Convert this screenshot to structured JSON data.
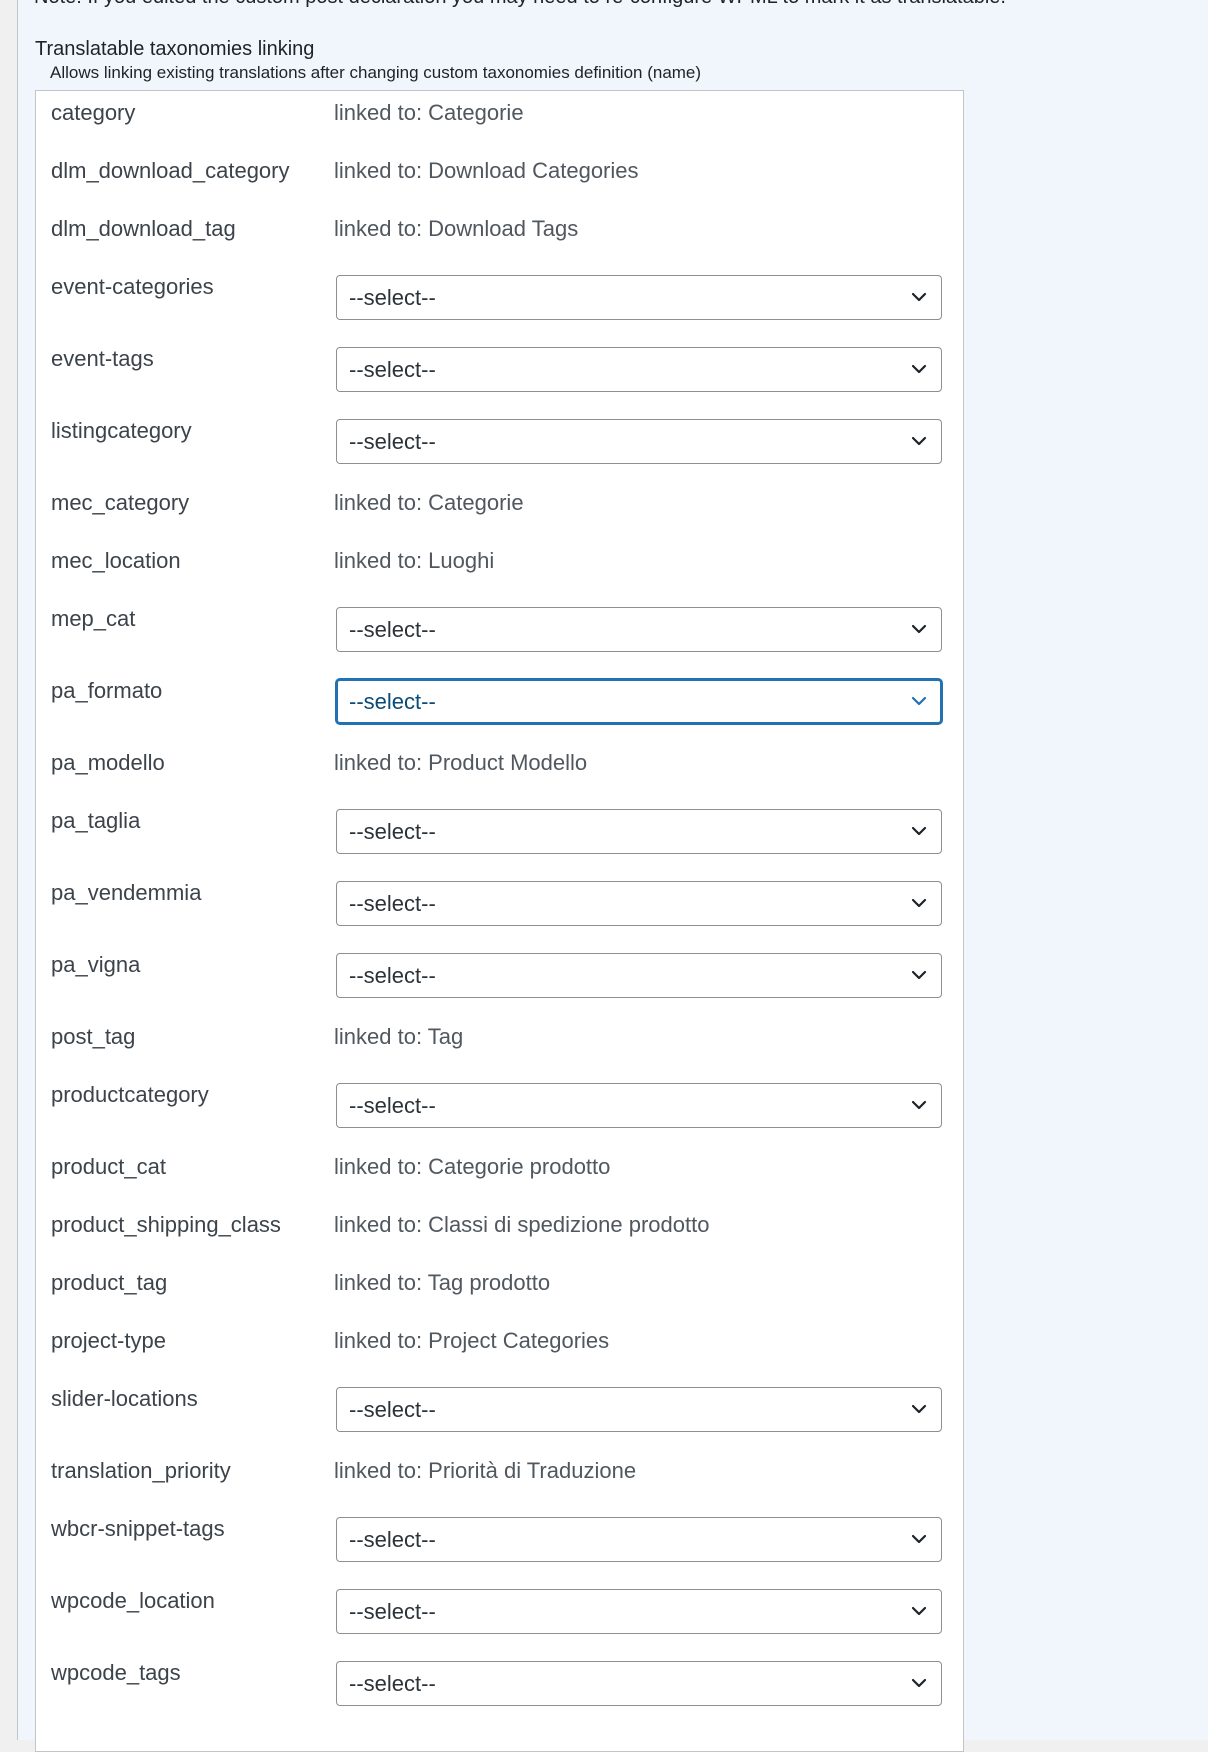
{
  "note_text": "Note: If you edited the custom post declaration you may need to re-configure WPML to mark it as translatable.",
  "section": {
    "title": "Translatable taxonomies linking",
    "description": "Allows linking existing translations after changing custom taxonomies definition (name)"
  },
  "rows": [
    {
      "name": "category",
      "type": "linked",
      "text": "linked to: Categorie"
    },
    {
      "name": "dlm_download_category",
      "type": "linked",
      "text": "linked to: Download Categories"
    },
    {
      "name": "dlm_download_tag",
      "type": "linked",
      "text": "linked to: Download Tags"
    },
    {
      "name": "event-categories",
      "type": "select",
      "text": "--select--"
    },
    {
      "name": "event-tags",
      "type": "select",
      "text": "--select--"
    },
    {
      "name": "listingcategory",
      "type": "select",
      "text": "--select--"
    },
    {
      "name": "mec_category",
      "type": "linked",
      "text": "linked to: Categorie"
    },
    {
      "name": "mec_location",
      "type": "linked",
      "text": "linked to: Luoghi"
    },
    {
      "name": "mep_cat",
      "type": "select",
      "text": "--select--"
    },
    {
      "name": "pa_formato",
      "type": "select",
      "text": "--select--",
      "focused": true
    },
    {
      "name": "pa_modello",
      "type": "linked",
      "text": "linked to: Product Modello"
    },
    {
      "name": "pa_taglia",
      "type": "select",
      "text": "--select--"
    },
    {
      "name": "pa_vendemmia",
      "type": "select",
      "text": "--select--"
    },
    {
      "name": "pa_vigna",
      "type": "select",
      "text": "--select--"
    },
    {
      "name": "post_tag",
      "type": "linked",
      "text": "linked to: Tag"
    },
    {
      "name": "productcategory",
      "type": "select",
      "text": "--select--"
    },
    {
      "name": "product_cat",
      "type": "linked",
      "text": "linked to: Categorie prodotto"
    },
    {
      "name": "product_shipping_class",
      "type": "linked",
      "text": "linked to: Classi di spedizione prodotto"
    },
    {
      "name": "product_tag",
      "type": "linked",
      "text": "linked to: Tag prodotto"
    },
    {
      "name": "project-type",
      "type": "linked",
      "text": "linked to: Project Categories"
    },
    {
      "name": "slider-locations",
      "type": "select",
      "text": "--select--"
    },
    {
      "name": "translation_priority",
      "type": "linked",
      "text": "linked to: Priorità di Traduzione"
    },
    {
      "name": "wbcr-snippet-tags",
      "type": "select",
      "text": "--select--"
    },
    {
      "name": "wpcode_location",
      "type": "select",
      "text": "--select--"
    },
    {
      "name": "wpcode_tags",
      "type": "select",
      "text": "--select--"
    }
  ]
}
